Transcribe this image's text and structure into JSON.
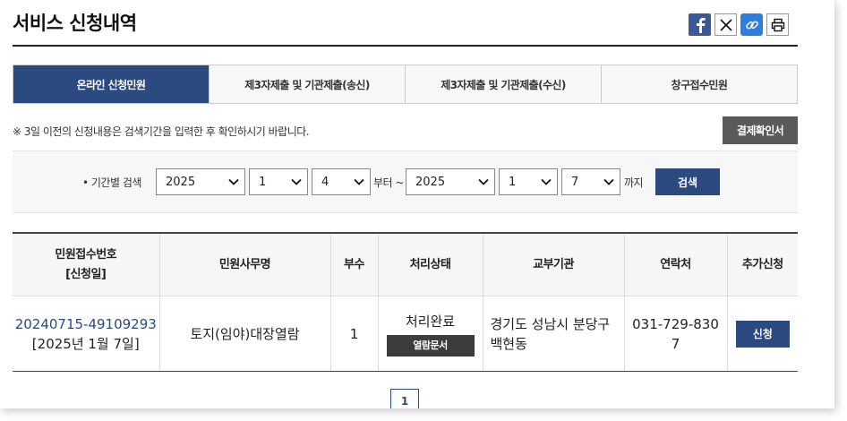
{
  "page": {
    "title": "서비스 신청내역"
  },
  "share": {
    "facebook_icon": "facebook-icon",
    "x_icon": "x-icon",
    "link_icon": "link-icon",
    "print_icon": "print-icon"
  },
  "tabs": [
    {
      "label": "온라인 신청민원",
      "active": true
    },
    {
      "label": "제3자제출 및 기관제출(송신)",
      "active": false
    },
    {
      "label": "제3자제출 및 기관제출(수신)",
      "active": false
    },
    {
      "label": "창구접수민원",
      "active": false
    }
  ],
  "notice": "※ 3일 이전의 신청내용은 검색기간을 입력한 후 확인하시기 바랍니다.",
  "receipt_button": "결제확인서",
  "search": {
    "label": "• 기간별 검색",
    "from_year": "2025",
    "from_month": "1",
    "from_day": "4",
    "from_suffix": "부터 ~",
    "to_year": "2025",
    "to_month": "1",
    "to_day": "7",
    "to_suffix": "까지",
    "button": "검색"
  },
  "table": {
    "headers": [
      "민원접수번호",
      "[신청일]",
      "민원사무명",
      "부수",
      "처리상태",
      "교부기관",
      "연락처",
      "추가신청"
    ],
    "rows": [
      {
        "app_no": "20240715-49109293",
        "app_date": "[2025년 1월 7일]",
        "service": "토지(임야)대장열람",
        "copies": "1",
        "status": "처리완료",
        "doc_button": "열람문서",
        "agency_line1": "경기도 성남시 분당구",
        "agency_line2": "백현동",
        "phone_line1": "031-729-830",
        "phone_line2": "7",
        "apply_button": "신청"
      }
    ]
  },
  "pagination": {
    "current": "1"
  }
}
